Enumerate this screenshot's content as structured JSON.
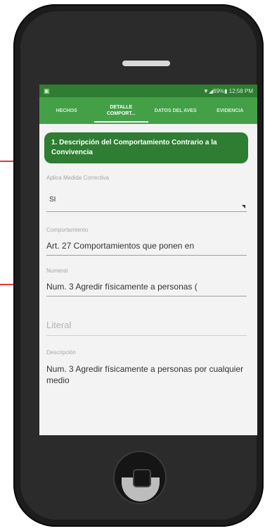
{
  "status_bar": {
    "left_icon": "notification-icon",
    "right_text": "▼◢89%▮ 12:58 PM"
  },
  "tabs": [
    {
      "label": "HECHOS"
    },
    {
      "label": "DETALLE COMPORT..."
    },
    {
      "label": "DATOS DEL AVES"
    },
    {
      "label": "EVIDENCIA"
    }
  ],
  "section_header": "1. Descripción del Comportamiento Contrario a la Convivencia",
  "fields": {
    "medida": {
      "label": "Aplica Medida Correctiva",
      "value": "SI"
    },
    "comportamiento": {
      "label": "Comportamiento",
      "value": "Art. 27 Comportamientos que ponen en"
    },
    "numeral": {
      "label": "Numeral",
      "value": "Num. 3 Agredir físicamente a personas ("
    },
    "literal": {
      "placeholder": "Literal"
    },
    "descripcion": {
      "label": "Descripción",
      "value": "Num. 3 Agredir físicamente a personas por cualquier medio"
    }
  },
  "colors": {
    "primary_dark": "#2e7d32",
    "primary": "#43a047",
    "annotation": "#e53935"
  }
}
